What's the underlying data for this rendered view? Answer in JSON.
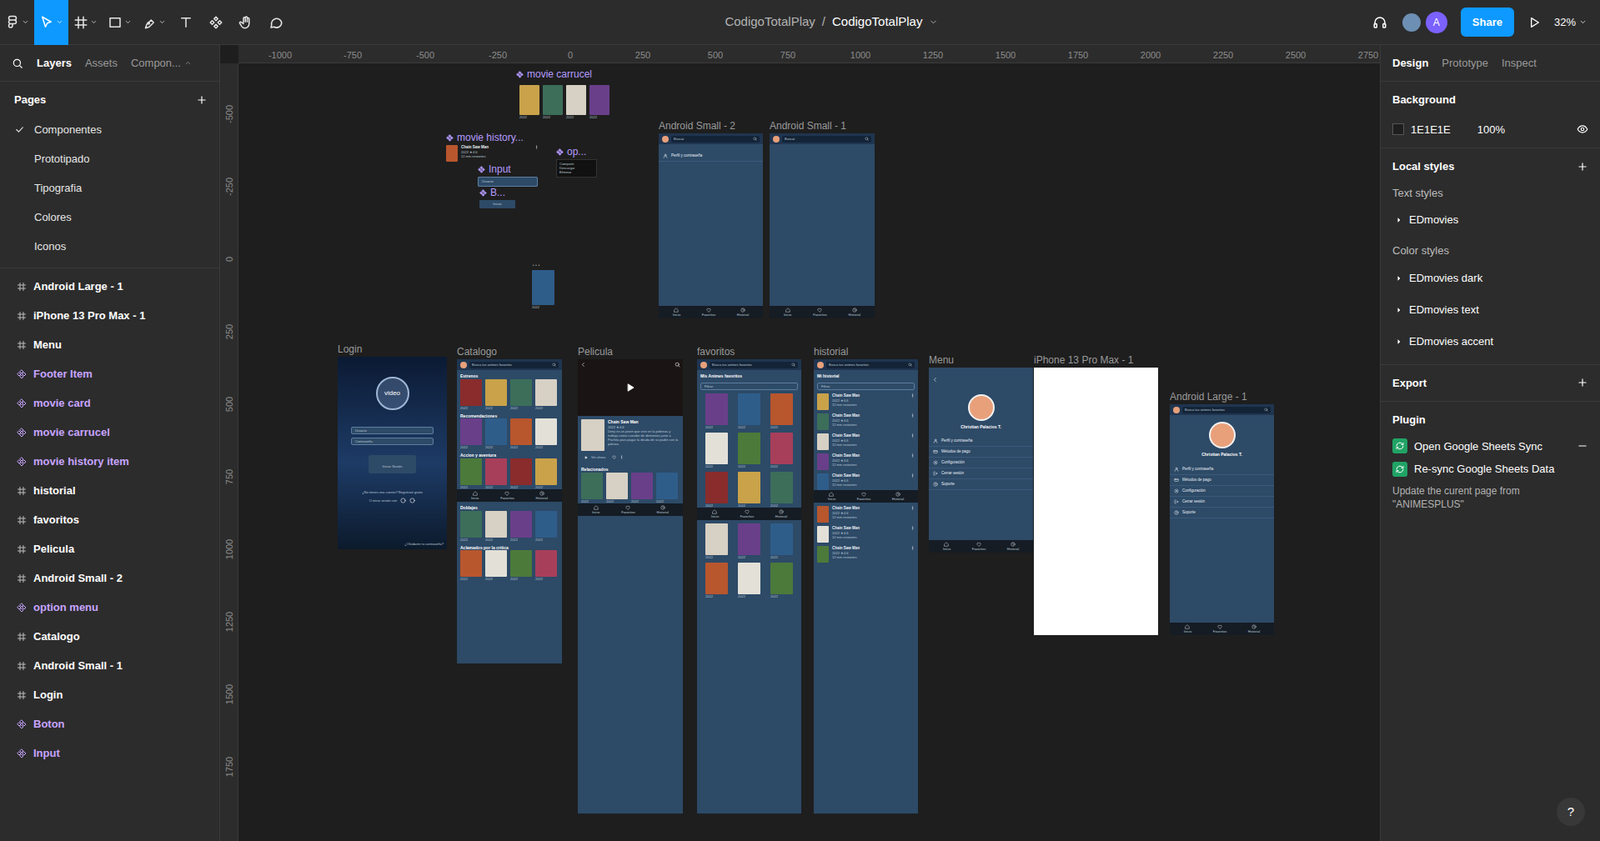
{
  "toolbar": {
    "tools": [
      {
        "selected": false
      },
      {
        "selected": true
      },
      {
        "selected": false
      },
      {
        "selected": false
      },
      {
        "selected": false
      },
      {
        "selected": false
      },
      {
        "selected": false
      },
      {
        "selected": false
      },
      {
        "selected": false
      }
    ],
    "project": "CodigoTotalPlay",
    "separator": "/",
    "file": "CodigoTotalPlay",
    "avatar_initial": "A",
    "share": "Share",
    "zoom": "32%"
  },
  "left_panel": {
    "tabs": [
      {
        "label": "Layers",
        "selected": true
      },
      {
        "label": "Assets",
        "selected": false
      },
      {
        "label": "Compon...",
        "selected": false
      }
    ],
    "pages_title": "Pages",
    "pages": [
      {
        "label": "Componentes",
        "selected": true
      },
      {
        "label": "Prototipado",
        "selected": false
      },
      {
        "label": "Tipografia",
        "selected": false
      },
      {
        "label": "Colores",
        "selected": false
      },
      {
        "label": "Iconos",
        "selected": false
      }
    ],
    "layers": [
      {
        "label": "Android Large - 1",
        "kind": "frame"
      },
      {
        "label": "iPhone 13 Pro Max - 1",
        "kind": "frame"
      },
      {
        "label": "Menu",
        "kind": "frame"
      },
      {
        "label": "Footer Item",
        "kind": "component"
      },
      {
        "label": "movie card",
        "kind": "component"
      },
      {
        "label": "movie carrucel",
        "kind": "component"
      },
      {
        "label": "movie history item",
        "kind": "component"
      },
      {
        "label": "historial",
        "kind": "frame"
      },
      {
        "label": "favoritos",
        "kind": "frame"
      },
      {
        "label": "Pelicula",
        "kind": "frame"
      },
      {
        "label": "Android Small - 2",
        "kind": "frame"
      },
      {
        "label": "option menu",
        "kind": "component"
      },
      {
        "label": "Catalogo",
        "kind": "frame"
      },
      {
        "label": "Android Small - 1",
        "kind": "frame"
      },
      {
        "label": "Login",
        "kind": "frame"
      },
      {
        "label": "Boton",
        "kind": "component"
      },
      {
        "label": "Input",
        "kind": "component"
      }
    ]
  },
  "rulers": {
    "x": [
      "-1000",
      "-750",
      "-500",
      "-250",
      "0",
      "250",
      "500",
      "750",
      "1000",
      "1250",
      "1500",
      "1750",
      "2000",
      "2250",
      "2500",
      "2750"
    ],
    "y": [
      "-500",
      "-250",
      "0",
      "250",
      "500",
      "750",
      "1000",
      "1250",
      "1500",
      "1750"
    ]
  },
  "canvas": {
    "frames": [
      {
        "label": "movie carrucel",
        "kind": "carousel",
        "component": true,
        "posters": [
          "2022",
          "2022",
          "2022",
          "2022"
        ]
      },
      {
        "label": "movie history...",
        "kind": "history-item",
        "component": true,
        "title": "Chain Saw Man",
        "meta": "2022 ★4.6",
        "detail": "12 min restantes"
      },
      {
        "label": "Input",
        "kind": "input",
        "component": true,
        "placeholder": "Usuario"
      },
      {
        "label": "B...",
        "kind": "button",
        "component": true,
        "text": "Iniciar"
      },
      {
        "label": "op...",
        "kind": "option-menu",
        "component": true,
        "options": [
          "Compartir",
          "Descargar",
          "Eliminar"
        ]
      },
      {
        "label": "...",
        "kind": "card",
        "component": false,
        "caption": "2022"
      },
      {
        "label": "Android Small - 2",
        "kind": "menu-screen",
        "component": false,
        "search": "Buscar",
        "items": [
          "Perfil y contraseña"
        ],
        "nav": [
          "Inicio",
          "Favoritos",
          "Historial"
        ]
      },
      {
        "label": "Android Small - 1",
        "kind": "menu-screen",
        "component": false,
        "search": "Buscar",
        "items": [],
        "nav": [
          "Inicio",
          "Favoritos",
          "Historial"
        ]
      },
      {
        "label": "Login",
        "kind": "login",
        "component": false,
        "logo": "video",
        "fields": [
          "Usuario",
          "Contraseña"
        ],
        "button": "Iniciar Sesión",
        "signup": "¿No tienes una cuenta? Registrate gratis",
        "social": "O inicia sesión con",
        "forgot": "¿Olvidaste tu contraseña?"
      },
      {
        "label": "Catalogo",
        "kind": "catalog",
        "component": false,
        "search": "Busca tus animes favoritos",
        "sections": [
          {
            "title": "Estrenos",
            "posters": [
              "2022",
              "2022",
              "2022",
              "2022"
            ]
          },
          {
            "title": "Recomendaciones",
            "posters": [
              "2022",
              "2022",
              "2022",
              "2022"
            ]
          },
          {
            "title": "Accion y aventura",
            "posters": [
              "2022",
              "2022",
              "2022",
              "2022"
            ]
          },
          {
            "title": "Doblajes",
            "posters": [
              "2022",
              "2022",
              "2022",
              "2022"
            ]
          },
          {
            "title": "Aclamados por la critica",
            "posters": [
              "2022",
              "2022",
              "2022",
              "2022"
            ]
          }
        ],
        "nav": [
          "Inicio",
          "Favoritos",
          "Historial"
        ]
      },
      {
        "label": "Pelicula",
        "kind": "movie",
        "component": false,
        "title": "Chain Saw Man",
        "meta": "2022 ★4.6",
        "synopsis": "Denji es un joven que vive en la pobreza y trabaja como cazador de demonios junto a Pochita para pagar la deuda de su padre con la yakuza.",
        "action": "Ver ahora",
        "related_title": "Relacionados",
        "related": [
          "2022",
          "2022",
          "2022",
          "2022"
        ],
        "nav": [
          "Inicio",
          "Favoritos",
          "Historial"
        ]
      },
      {
        "label": "favoritos",
        "kind": "favorites",
        "component": false,
        "search": "Busca tus animes favoritos",
        "heading": "Mis Animes favoritos",
        "filter": "Filtrar",
        "posters": [
          "2022",
          "2022",
          "2022",
          "2022",
          "2022",
          "2022",
          "2022",
          "2022",
          "2022",
          "2022",
          "2022",
          "2022",
          "2022",
          "2022",
          "2022"
        ],
        "nav": [
          "Inicio",
          "Favoritos",
          "Historial"
        ]
      },
      {
        "label": "historial",
        "kind": "history",
        "component": false,
        "search": "Busca tus animes favoritos",
        "heading": "Mi historial",
        "filter": "Filtrar",
        "items": [
          {
            "title": "Chain Saw Man",
            "meta": "2022 ★4.6",
            "detail": "12 min restantes"
          },
          {
            "title": "Chain Saw Man",
            "meta": "2022 ★4.6",
            "detail": "12 min restantes"
          },
          {
            "title": "Chain Saw Man",
            "meta": "2022 ★4.6",
            "detail": "12 min restantes"
          },
          {
            "title": "Chain Saw Man",
            "meta": "2022 ★4.6",
            "detail": "12 min restantes"
          },
          {
            "title": "Chain Saw Man",
            "meta": "2022 ★4.6",
            "detail": "12 min restantes"
          },
          {
            "title": "Chain Saw Man",
            "meta": "2022 ★4.6",
            "detail": "12 min restantes"
          },
          {
            "title": "Chain Saw Man",
            "meta": "2022 ★4.6",
            "detail": "12 min restantes"
          },
          {
            "title": "Chain Saw Man",
            "meta": "2022 ★4.6",
            "detail": "12 min restantes"
          }
        ],
        "nav": [
          "Inicio",
          "Favoritos",
          "Historial"
        ]
      },
      {
        "label": "Menu",
        "kind": "profile",
        "component": false,
        "name": "Christian Palacios T.",
        "items": [
          "Perfil y contraseña",
          "Métodos de pago",
          "Configuración",
          "Cerrar sesión",
          "Soporte"
        ],
        "nav": [
          "Inicio",
          "Favoritos",
          "Historial"
        ]
      },
      {
        "label": "iPhone 13 Pro Max - 1",
        "kind": "blank",
        "component": false
      },
      {
        "label": "Android Large - 1",
        "kind": "profile",
        "component": false,
        "search": "Busca tus animes favoritos",
        "name": "Christian Palacios T.",
        "items": [
          "Perfil y contraseña",
          "Métodos de pago",
          "Configuración",
          "Cerrar sesión",
          "Soporte"
        ],
        "nav": [
          "Inicio",
          "Favoritos",
          "Historial"
        ]
      }
    ]
  },
  "right_panel": {
    "tabs": [
      {
        "label": "Design",
        "selected": true
      },
      {
        "label": "Prototype",
        "selected": false
      },
      {
        "label": "Inspect",
        "selected": false
      }
    ],
    "background": {
      "title": "Background",
      "hex": "1E1E1E",
      "opacity": "100%"
    },
    "local_styles": {
      "title": "Local styles",
      "text_title": "Text styles",
      "text_styles": [
        "EDmovies"
      ],
      "color_title": "Color styles",
      "color_styles": [
        "EDmovies dark",
        "EDmovies text",
        "EDmovies accent"
      ]
    },
    "export": {
      "title": "Export"
    },
    "plugin": {
      "title": "Plugin",
      "items": [
        {
          "label": "Open Google Sheets Sync",
          "expanded": true
        },
        {
          "label": "Re-sync Google Sheets Data",
          "expanded": false
        }
      ],
      "note": "Update the curent page from \"ANIMESPLUS\""
    }
  },
  "help": "?"
}
